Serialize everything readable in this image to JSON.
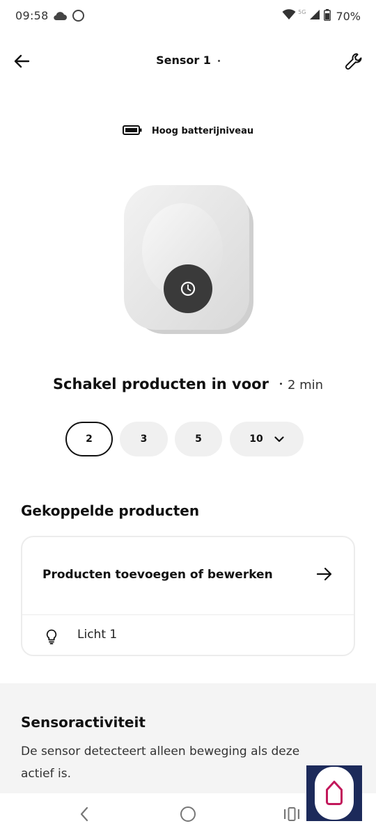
{
  "status_bar": {
    "time": "09:58",
    "network": "5G",
    "battery_percent": "70%"
  },
  "header": {
    "title": "Sensor 1"
  },
  "battery": {
    "label": "Hoog batterijniveau"
  },
  "delay": {
    "title": "Schakel producten in voor",
    "value": "2 min",
    "options": [
      "2",
      "3",
      "5",
      "10"
    ],
    "selected": "2"
  },
  "linked_products": {
    "title": "Gekoppelde producten",
    "add_edit_label": "Producten toevoegen of bewerken",
    "items": [
      {
        "name": "Licht 1",
        "icon": "bulb-icon"
      }
    ]
  },
  "sensor_activity": {
    "title": "Sensoractiviteit",
    "description": "De sensor detecteert alleen beweging als deze actief is."
  },
  "colors": {
    "accent": "#1c2a5a",
    "fab_icon": "#c2185b",
    "device_button": "#3a3a3a"
  }
}
